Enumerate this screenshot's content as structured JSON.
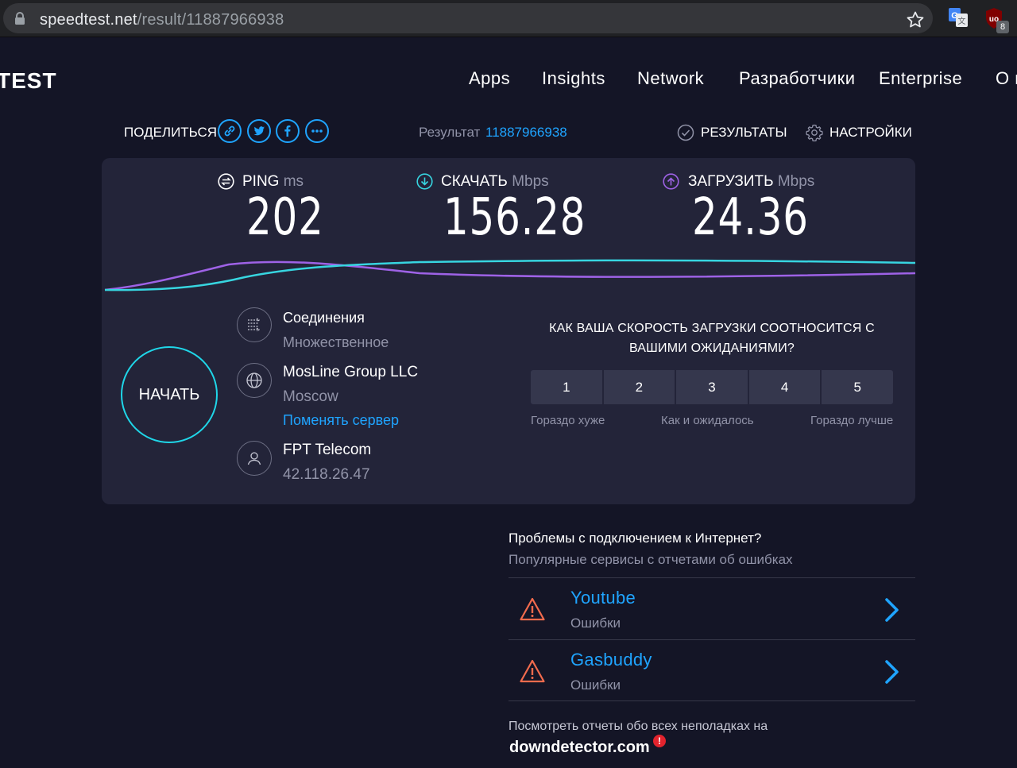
{
  "browser": {
    "url_host": "speedtest.net",
    "url_path": "/result/11887966938",
    "extension_badge": "8",
    "icons": [
      "lock-icon",
      "star-icon",
      "translate-icon",
      "ublock-icon"
    ]
  },
  "header": {
    "logo": "TEST",
    "nav": [
      "Apps",
      "Insights",
      "Network",
      "Разработчики",
      "Enterprise",
      "О г"
    ]
  },
  "share": {
    "label": "ПОДЕЛИТЬСЯ",
    "icons": [
      "link-icon",
      "twitter-icon",
      "facebook-icon",
      "more-icon"
    ]
  },
  "result": {
    "label": "Результат",
    "id": "11887966938"
  },
  "top_links": {
    "results": "РЕЗУЛЬТАТЫ",
    "settings": "НАСТРОЙКИ"
  },
  "metrics": {
    "ping": {
      "label": "PING",
      "unit": "ms",
      "value": "202"
    },
    "download": {
      "label": "СКАЧАТЬ",
      "unit": "Mbps",
      "value": "156.28"
    },
    "upload": {
      "label": "ЗАГРУЗИТЬ",
      "unit": "Mbps",
      "value": "24.36"
    }
  },
  "colors": {
    "download": "#37d5e0",
    "upload": "#9e62e6",
    "accent": "#1fa4ff",
    "warning": "#f26b4d"
  },
  "go_button": "НАЧАТЬ",
  "server": {
    "connections_title": "Соединения",
    "connections_value": "Множественное",
    "host_name": "MosLine Group LLC",
    "host_city": "Moscow",
    "change_server": "Поменять сервер",
    "isp_name": "FPT Telecom",
    "isp_ip": "42.118.26.47"
  },
  "rating": {
    "question": "КАК ВАША СКОРОСТЬ ЗАГРУЗКИ СООТНОСИТСЯ С ВАШИМИ ОЖИДАНИЯМИ?",
    "options": [
      "1",
      "2",
      "3",
      "4",
      "5"
    ],
    "low_label": "Гораздо хуже",
    "mid_label": "Как и ожидалось",
    "high_label": "Гораздо лучше"
  },
  "problems": {
    "title": "Проблемы с подключением к Интернет?",
    "subtitle": "Популярные сервисы с отчетами об ошибках",
    "services": [
      {
        "name": "Youtube",
        "status": "Ошибки"
      },
      {
        "name": "Gasbuddy",
        "status": "Ошибки"
      }
    ],
    "footer_text": "Посмотреть отчеты обо всех неполадках на",
    "footer_brand": "downdetector.com"
  }
}
